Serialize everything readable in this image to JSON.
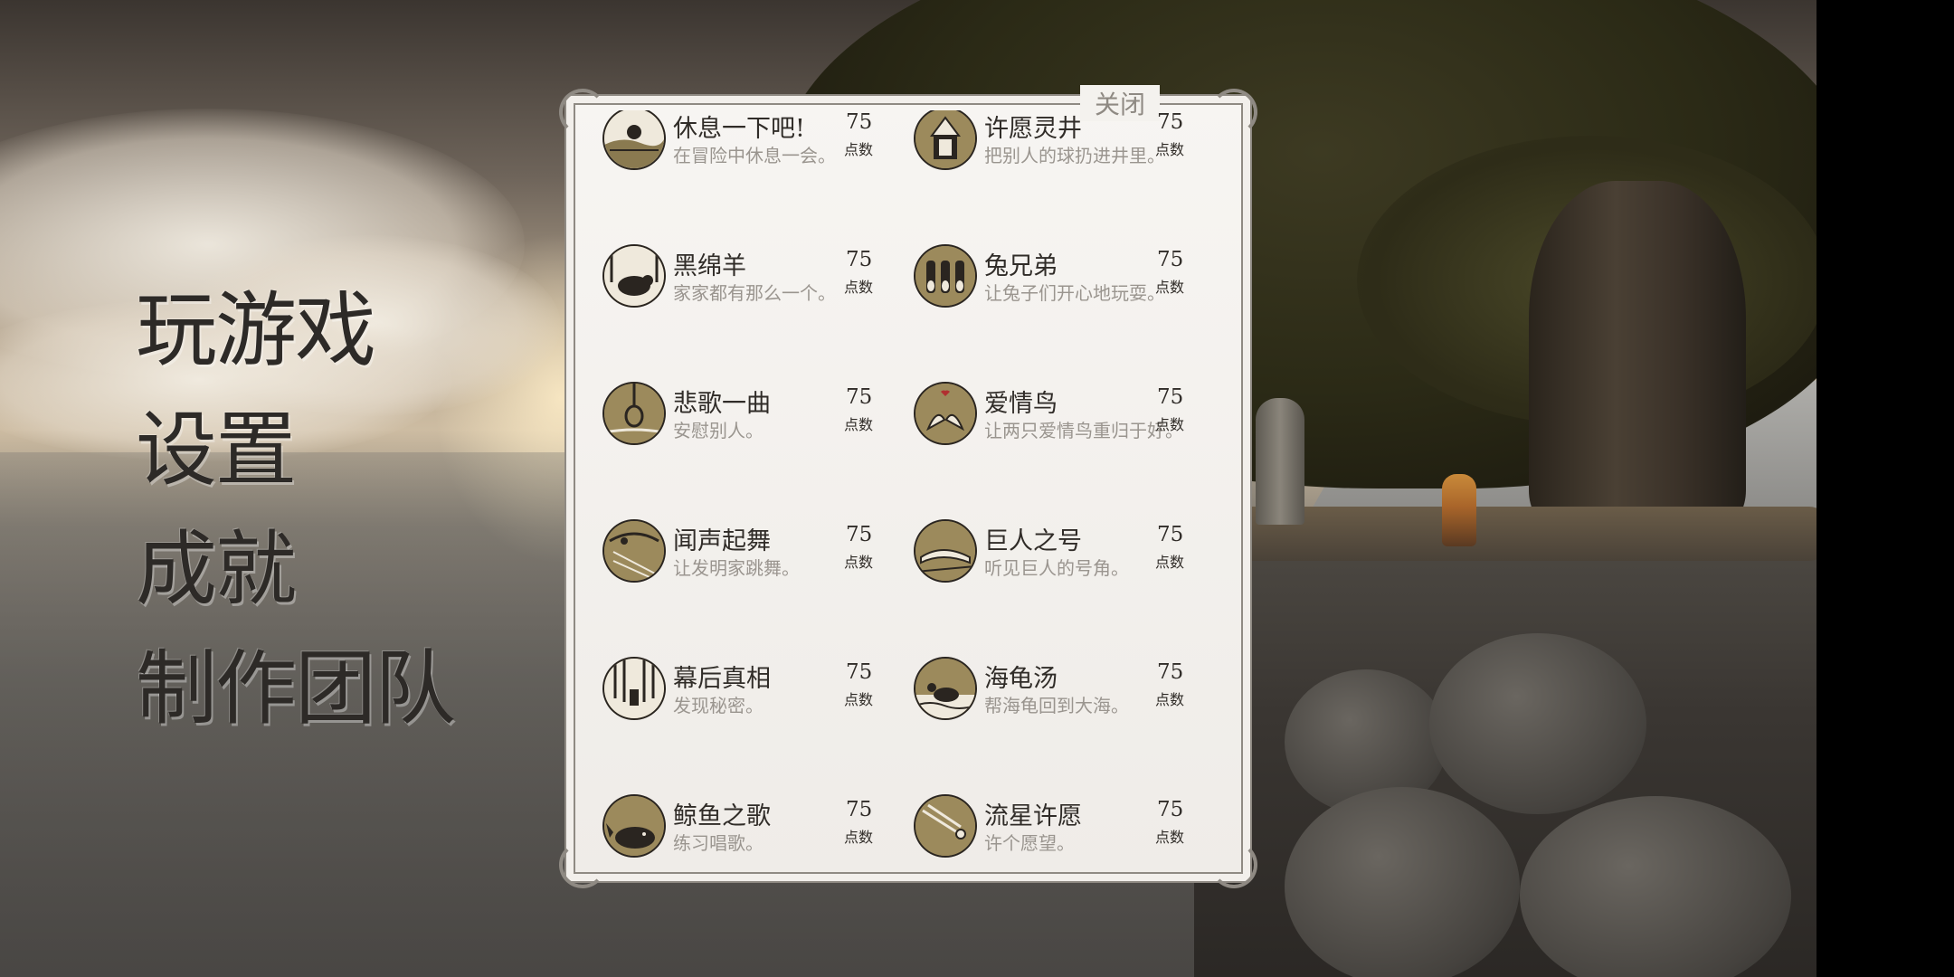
{
  "menu": {
    "items": [
      "玩游戏",
      "设置",
      "成就",
      "制作团队"
    ]
  },
  "panel": {
    "close_label": "关闭",
    "achievements": [
      {
        "title": "休息一下吧!",
        "desc": "在冒险中休息一会。",
        "points": "75",
        "unit": "点数",
        "icon": "resting-landscape-icon"
      },
      {
        "title": "许愿灵井",
        "desc": "把别人的球扔进井里。",
        "points": "75",
        "unit": "点数",
        "icon": "wishing-well-icon"
      },
      {
        "title": "黑绵羊",
        "desc": "家家都有那么一个。",
        "points": "75",
        "unit": "点数",
        "icon": "black-sheep-icon"
      },
      {
        "title": "兔兄弟",
        "desc": "让兔子们开心地玩耍。",
        "points": "75",
        "unit": "点数",
        "icon": "rabbits-icon"
      },
      {
        "title": "悲歌一曲",
        "desc": "安慰别人。",
        "points": "75",
        "unit": "点数",
        "icon": "noose-icon"
      },
      {
        "title": "爱情鸟",
        "desc": "让两只爱情鸟重归于好。",
        "points": "75",
        "unit": "点数",
        "icon": "love-birds-icon"
      },
      {
        "title": "闻声起舞",
        "desc": "让发明家跳舞。",
        "points": "75",
        "unit": "点数",
        "icon": "dancing-note-icon"
      },
      {
        "title": "巨人之号",
        "desc": "听见巨人的号角。",
        "points": "75",
        "unit": "点数",
        "icon": "giant-horn-icon"
      },
      {
        "title": "幕后真相",
        "desc": "发现秘密。",
        "points": "75",
        "unit": "点数",
        "icon": "curtain-secret-icon"
      },
      {
        "title": "海龟汤",
        "desc": "帮海龟回到大海。",
        "points": "75",
        "unit": "点数",
        "icon": "sea-turtle-icon"
      },
      {
        "title": "鲸鱼之歌",
        "desc": "练习唱歌。",
        "points": "75",
        "unit": "点数",
        "icon": "whale-icon"
      },
      {
        "title": "流星许愿",
        "desc": "许个愿望。",
        "points": "75",
        "unit": "点数",
        "icon": "shooting-star-icon"
      }
    ]
  },
  "colors": {
    "panel_bg": "#f3f1ee",
    "panel_border": "#8f8a83",
    "badge_gold": "#9c8a5c",
    "title_text": "#302c28",
    "desc_text": "#9a958f",
    "menu_text": "#2d2a27"
  }
}
